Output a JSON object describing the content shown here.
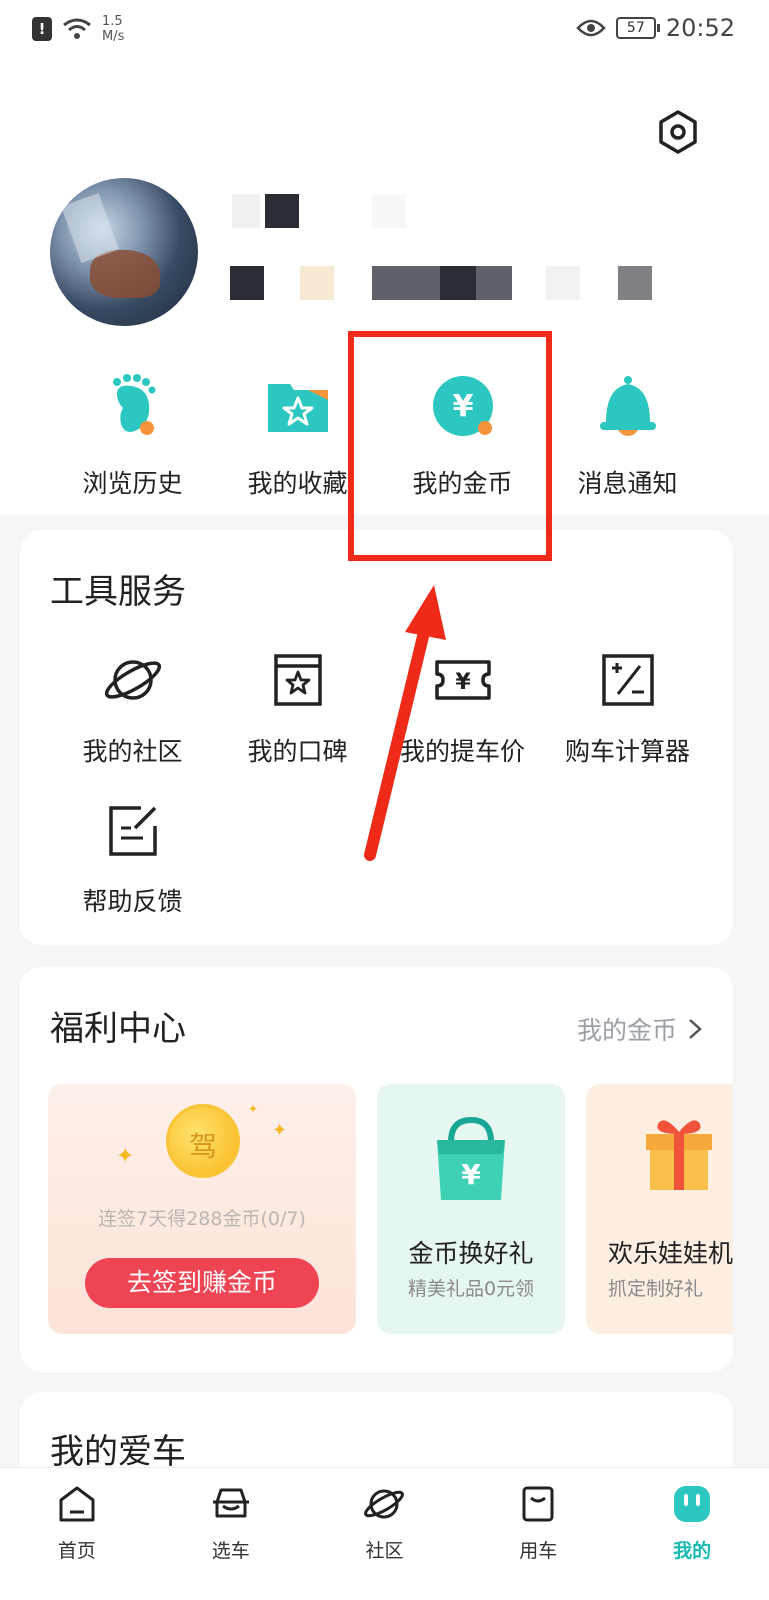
{
  "status_bar": {
    "speed_value": "1.5",
    "speed_unit": "M/s",
    "battery": "57",
    "time": "20:52"
  },
  "quick_actions": [
    {
      "label": "浏览历史",
      "icon": "footprint-icon"
    },
    {
      "label": "我的收藏",
      "icon": "favorites-folder-icon"
    },
    {
      "label": "我的金币",
      "icon": "gold-coin-icon"
    },
    {
      "label": "消息通知",
      "icon": "bell-icon"
    }
  ],
  "tools": {
    "title": "工具服务",
    "items": [
      {
        "label": "我的社区",
        "icon": "planet-icon"
      },
      {
        "label": "我的口碑",
        "icon": "review-star-icon"
      },
      {
        "label": "我的提车价",
        "icon": "price-ticket-icon"
      },
      {
        "label": "购车计算器",
        "icon": "calculator-icon"
      },
      {
        "label": "帮助反馈",
        "icon": "feedback-edit-icon"
      }
    ]
  },
  "welfare": {
    "title": "福利中心",
    "more_label": "我的金币",
    "signin": {
      "desc": "连签7天得288金币(0/7)",
      "button": "去签到赚金币"
    },
    "exchange": {
      "title": "金币换好礼",
      "subtitle": "精美礼品0元领"
    },
    "doll": {
      "title": "欢乐娃娃机",
      "subtitle": "抓定制好礼"
    }
  },
  "car": {
    "title": "我的爱车"
  },
  "tabbar": [
    {
      "label": "首页",
      "icon": "home-icon",
      "active": false
    },
    {
      "label": "选车",
      "icon": "car-select-icon",
      "active": false
    },
    {
      "label": "社区",
      "icon": "planet-icon",
      "active": false
    },
    {
      "label": "用车",
      "icon": "car-use-icon",
      "active": false
    },
    {
      "label": "我的",
      "icon": "profile-icon",
      "active": true
    }
  ],
  "colors": {
    "accent": "#17b9b1",
    "highlight_box": "#f02a18",
    "sign_button": "#ef4454"
  }
}
